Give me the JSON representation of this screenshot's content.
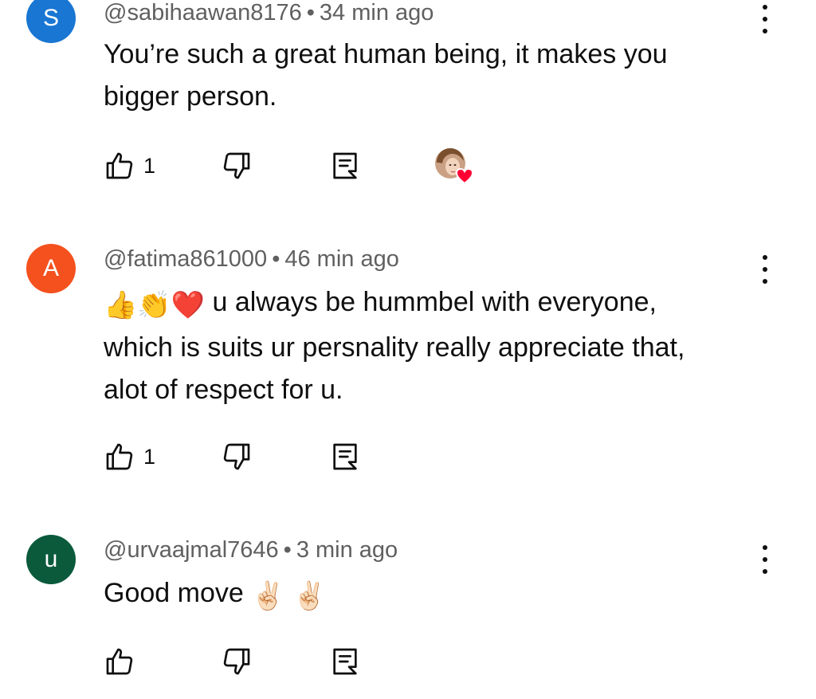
{
  "colors": {
    "avatar_s": "#1976d2",
    "avatar_a": "#f4511e",
    "avatar_u": "#0b5a3c",
    "meta_text": "#606060",
    "heart": "#ff0033"
  },
  "comments": [
    {
      "avatar_letter": "S",
      "handle": "@sabihaawan8176",
      "time": "34 min ago",
      "text_line1": "You’re such a great human being, it makes you",
      "text_line2": "bigger person.",
      "like_count": "1",
      "has_creator_heart": true
    },
    {
      "avatar_letter": "A",
      "handle": "@fatima861000",
      "time": "46 min ago",
      "emojis_prefix": "👍👏❤️",
      "text_line1": "u always be hummbel with everyone,",
      "text_line2": "which is suits ur persnality really appreciate that,",
      "text_line3": "alot of respect for u.",
      "like_count": "1"
    },
    {
      "avatar_letter": "u",
      "handle": "@urvaajmal7646",
      "time": "3 min ago",
      "text": "Good move",
      "emojis_suffix": "✌🏻 ✌🏻",
      "like_count": ""
    }
  ],
  "separator": "•",
  "icons": {
    "like": "thumbs-up-icon",
    "dislike": "thumbs-down-icon",
    "reply": "reply-comment-icon",
    "more": "more-vert-icon",
    "heart": "creator-heart-icon"
  }
}
